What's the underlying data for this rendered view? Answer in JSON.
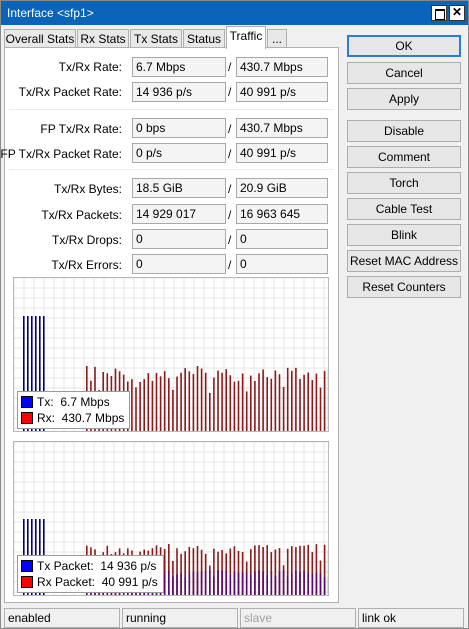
{
  "window": {
    "title": "Interface <sfp1>"
  },
  "tabs": [
    {
      "label": "Overall Stats"
    },
    {
      "label": "Rx Stats"
    },
    {
      "label": "Tx Stats"
    },
    {
      "label": "Status"
    },
    {
      "label": "Traffic",
      "active": true
    },
    {
      "label": "..."
    }
  ],
  "stats": {
    "txrx_rate": {
      "label": "Tx/Rx Rate:",
      "tx": "6.7 Mbps",
      "rx": "430.7 Mbps"
    },
    "txrx_packet_rate": {
      "label": "Tx/Rx Packet Rate:",
      "tx": "14 936 p/s",
      "rx": "40 991 p/s"
    },
    "fp_txrx_rate": {
      "label": "FP Tx/Rx Rate:",
      "tx": "0 bps",
      "rx": "430.7 Mbps"
    },
    "fp_txrx_packet_rate": {
      "label": "FP Tx/Rx Packet Rate:",
      "tx": "0 p/s",
      "rx": "40 991 p/s"
    },
    "txrx_bytes": {
      "label": "Tx/Rx Bytes:",
      "tx": "18.5 GiB",
      "rx": "20.9 GiB"
    },
    "txrx_packets": {
      "label": "Tx/Rx Packets:",
      "tx": "14 929 017",
      "rx": "16 963 645"
    },
    "txrx_drops": {
      "label": "Tx/Rx Drops:",
      "tx": "0",
      "rx": "0"
    },
    "txrx_errors": {
      "label": "Tx/Rx Errors:",
      "tx": "0",
      "rx": "0"
    },
    "separator": "/"
  },
  "graphs": {
    "traffic": {
      "legend": [
        {
          "label": "Tx:",
          "value": "6.7 Mbps",
          "color": "#0000ff"
        },
        {
          "label": "Rx:",
          "value": "430.7 Mbps",
          "color": "#ff0000"
        }
      ]
    },
    "packets": {
      "legend": [
        {
          "label": "Tx Packet:",
          "value": "14 936 p/s",
          "color": "#0000ff"
        },
        {
          "label": "Rx Packet:",
          "value": "40 991 p/s",
          "color": "#ff0000"
        }
      ]
    }
  },
  "buttons": [
    {
      "label": "OK",
      "primary": true
    },
    {
      "label": "Cancel"
    },
    {
      "label": "Apply"
    },
    {
      "label": "Disable"
    },
    {
      "label": "Comment"
    },
    {
      "label": "Torch"
    },
    {
      "label": "Cable Test"
    },
    {
      "label": "Blink"
    },
    {
      "label": "Reset MAC Address"
    },
    {
      "label": "Reset Counters"
    }
  ],
  "status_bar": [
    {
      "text": "enabled"
    },
    {
      "text": "running"
    },
    {
      "text": "slave",
      "muted": true
    },
    {
      "text": "link ok"
    }
  ],
  "colors": {
    "titlebar": "#0a64b8",
    "tx_bars": "#00007a",
    "rx_bars": "#8b1a1a",
    "packets_tx_bars": "#5a0a6e"
  }
}
